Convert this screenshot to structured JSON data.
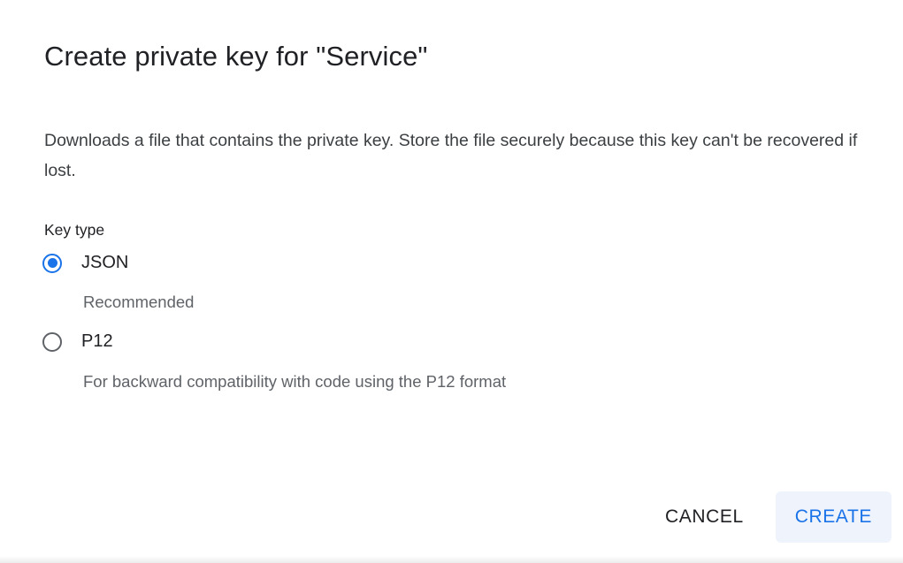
{
  "dialog": {
    "title": "Create private key for \"Service\"",
    "description": "Downloads a file that contains the private key. Store the file securely because this key can't be recovered if lost.",
    "key_type_label": "Key type",
    "options": [
      {
        "label": "JSON",
        "hint": "Recommended",
        "selected": true
      },
      {
        "label": "P12",
        "hint": "For backward compatibility with code using the P12 format",
        "selected": false
      }
    ],
    "actions": {
      "cancel_label": "CANCEL",
      "create_label": "CREATE"
    }
  },
  "colors": {
    "accent": "#1a73e8",
    "create_button_bg": "#eef3fc",
    "text_primary": "#202124",
    "text_secondary": "#5f6368"
  }
}
